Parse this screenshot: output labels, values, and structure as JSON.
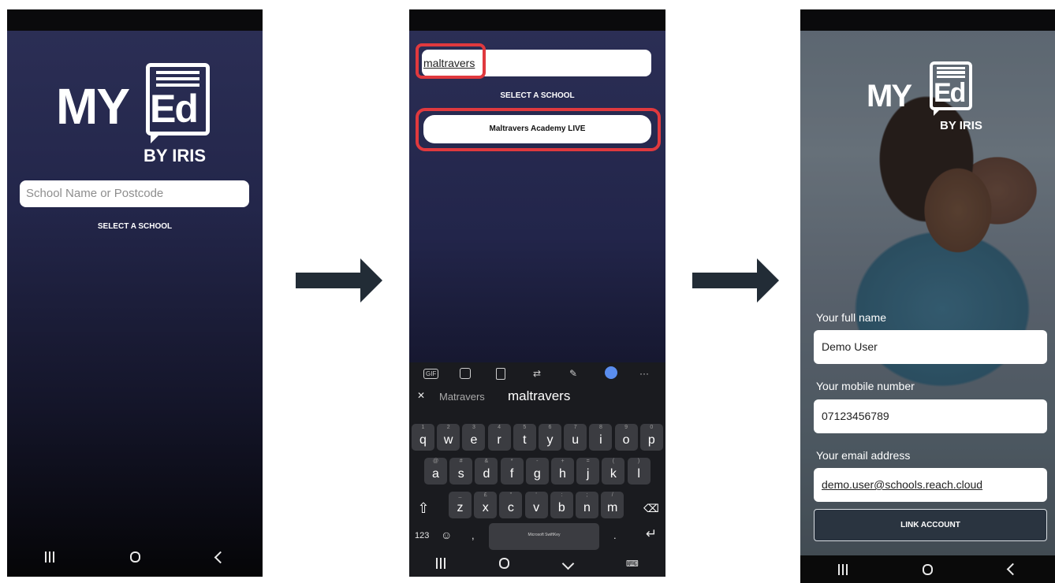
{
  "screens": {
    "search_screen": {
      "logo": {
        "my": "MY",
        "ed": "Ed",
        "by": "BY IRIS"
      },
      "search": {
        "placeholder": "School Name or Postcode"
      },
      "select_label": "SELECT A SCHOOL"
    },
    "results_screen": {
      "search": {
        "value": "maltravers"
      },
      "select_label": "SELECT A SCHOOL",
      "school_result": "Maltravers Academy LIVE",
      "keyboard": {
        "toolbar": [
          "GIF",
          "sticker-icon",
          "clipboard-icon",
          "translate-icon",
          "pen-icon",
          "bulb-icon",
          "more-icon"
        ],
        "more_label": "···",
        "suggestions": [
          "Matravers",
          "maltravers"
        ],
        "row1": [
          [
            "q",
            "1"
          ],
          [
            "w",
            "2"
          ],
          [
            "e",
            "3"
          ],
          [
            "r",
            "4"
          ],
          [
            "t",
            "5"
          ],
          [
            "y",
            "6"
          ],
          [
            "u",
            "7"
          ],
          [
            "i",
            "8"
          ],
          [
            "o",
            "9"
          ],
          [
            "p",
            "0"
          ]
        ],
        "row2": [
          [
            "a",
            "@"
          ],
          [
            "s",
            "#"
          ],
          [
            "d",
            "&"
          ],
          [
            "f",
            "*"
          ],
          [
            "g",
            "-"
          ],
          [
            "h",
            "+"
          ],
          [
            "j",
            "="
          ],
          [
            "k",
            "("
          ],
          [
            "l",
            ")"
          ]
        ],
        "row3": [
          [
            "z",
            "_"
          ],
          [
            "x",
            "£"
          ],
          [
            "c",
            "\""
          ],
          [
            "v",
            "'"
          ],
          [
            "b",
            ":"
          ],
          [
            "n",
            ";"
          ],
          [
            "m",
            "/"
          ]
        ],
        "numbers_label": "123",
        "space_label": "Microsoft SwiftKey",
        "period": ".",
        "comma": ","
      }
    },
    "link_screen": {
      "logo": {
        "my": "MY",
        "ed": "Ed",
        "by": "BY IRIS"
      },
      "full_name": {
        "label": "Your full name",
        "value": "Demo User"
      },
      "mobile": {
        "label": "Your mobile number",
        "value": "07123456789"
      },
      "email": {
        "label": "Your email address",
        "value": "demo.user@schools.reach.cloud"
      },
      "link_button": "LINK ACCOUNT"
    }
  },
  "colors": {
    "navy": "#2c2f56",
    "highlight_red": "#e0393e",
    "arrow": "#222c36",
    "button_dark": "#2a3440"
  }
}
